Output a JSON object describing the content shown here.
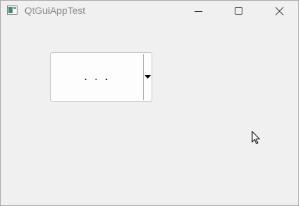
{
  "window": {
    "title": "QtGuiAppTest",
    "icons": {
      "app": "app-window-icon",
      "minimize": "minimize-icon",
      "maximize": "maximize-icon",
      "close": "close-icon"
    }
  },
  "combo": {
    "current_value": ". . .",
    "arrow_icon": "dropdown-arrow-icon"
  },
  "cursor": {
    "icon": "mouse-pointer-icon"
  },
  "colors": {
    "background": "#f0f0f0",
    "title_text": "#8a8a8a",
    "combo_bg": "#fdfdfd",
    "combo_border": "#c6c6c6"
  }
}
